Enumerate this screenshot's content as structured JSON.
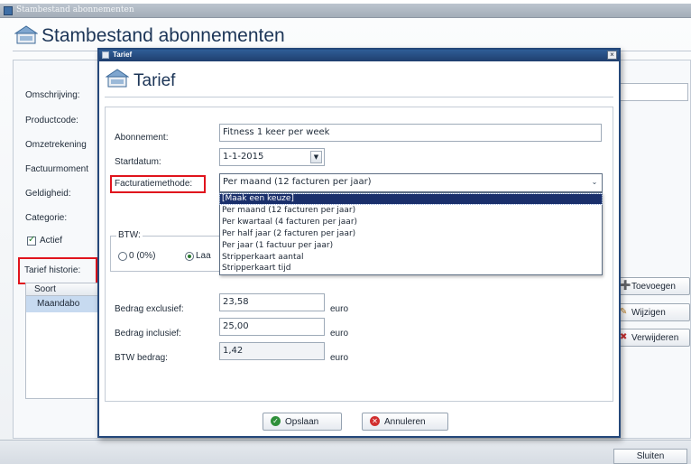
{
  "background": {
    "window_title": "Stambestand abonnementen",
    "header_title": "Stambestand abonnementen",
    "labels": {
      "omschrijving": "Omschrijving:",
      "productcode": "Productcode:",
      "omzetrekening": "Omzetrekening",
      "factuurmoment": "Factuurmoment",
      "geldigheid": "Geldigheid:",
      "categorie": "Categorie:",
      "actief": "Actief",
      "tarief_historie": "Tarief historie:"
    },
    "actief_checked": true,
    "table": {
      "column_header": "Soort",
      "rows": [
        "Maandabo"
      ]
    },
    "side_buttons": {
      "add": "Toevoegen",
      "edit": "Wijzigen",
      "delete": "Verwijderen"
    },
    "close_button": "Sluiten"
  },
  "dialog": {
    "window_title": "Tarief",
    "close_glyph": "×",
    "header_title": "Tarief",
    "fields": {
      "abonnement_label": "Abonnement:",
      "abonnement_value": "Fitness 1 keer per week",
      "startdatum_label": "Startdatum:",
      "startdatum_value": "1-1-2015",
      "facturatie_label": "Facturatiemethode:",
      "facturatie_value": "Per maand (12 facturen per jaar)"
    },
    "dropdown_options": [
      "[Maak een keuze]",
      "Per maand (12 facturen per jaar)",
      "Per kwartaal (4 facturen per jaar)",
      "Per half jaar (2 facturen per jaar)",
      "Per jaar (1 factuur per jaar)",
      "Stripperkaart aantal",
      "Stripperkaart tijd"
    ],
    "dropdown_selected_index": 0,
    "btw": {
      "legend": "BTW:",
      "option_0": "0 (0%)",
      "option_1": "Laa"
    },
    "amounts": {
      "excl_label": "Bedrag exclusief:",
      "excl_value": "23,58",
      "incl_label": "Bedrag inclusief:",
      "incl_value": "25,00",
      "btw_label": "BTW bedrag:",
      "btw_value": "1,42",
      "currency": "euro"
    },
    "buttons": {
      "save": "Opslaan",
      "cancel": "Annuleren"
    }
  },
  "colors": {
    "highlight": "#e0141d",
    "dialog_border": "#25487a",
    "selection": "#1a2f6b"
  }
}
